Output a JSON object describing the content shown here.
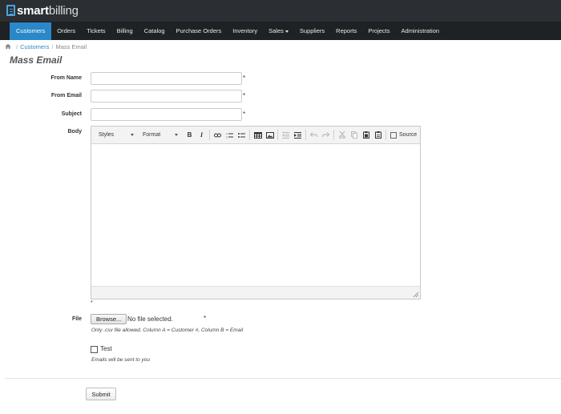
{
  "app": {
    "logo_bold": "smart",
    "logo_light": "billing"
  },
  "nav": [
    {
      "label": "Customers",
      "active": true
    },
    {
      "label": "Orders"
    },
    {
      "label": "Tickets"
    },
    {
      "label": "Billing"
    },
    {
      "label": "Catalog"
    },
    {
      "label": "Purchase Orders"
    },
    {
      "label": "Inventory"
    },
    {
      "label": "Sales"
    },
    {
      "label": "Suppliers"
    },
    {
      "label": "Reports"
    },
    {
      "label": "Projects"
    },
    {
      "label": "Administration"
    }
  ],
  "breadcrumb": {
    "parent": "Customers",
    "separator": "/",
    "current": "Mass Email"
  },
  "page": {
    "title": "Mass Email"
  },
  "form": {
    "from_name": {
      "label": "From Name",
      "value": "",
      "required": "*"
    },
    "from_email": {
      "label": "From Email",
      "value": "",
      "required": "*"
    },
    "subject": {
      "label": "Subject",
      "value": "",
      "required": "*"
    },
    "body": {
      "label": "Body",
      "required": "*",
      "toolbar": {
        "styles": "Styles",
        "format": "Format",
        "bold": "B",
        "italic": "I",
        "source": "Source"
      }
    },
    "file": {
      "label": "File",
      "browse": "Browse...",
      "status": "No file selected.",
      "required": "*",
      "help": "Only .csv file allowed. Column A = Customer #, Column B = Email"
    },
    "test": {
      "label": "Test",
      "checked": false,
      "help": "Emails will be sent to you"
    },
    "submit": "Submit"
  },
  "colors": {
    "accent": "#2a87c8",
    "topbar": "#2b2f33",
    "navbar": "#1f2225"
  }
}
